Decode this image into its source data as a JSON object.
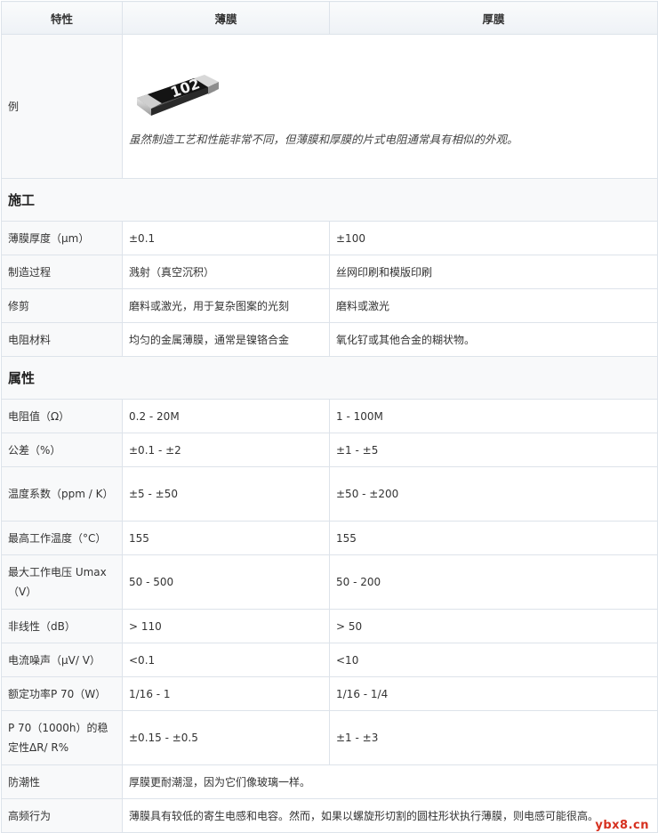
{
  "header": {
    "col1": "特性",
    "col2": "薄膜",
    "col3": "厚膜"
  },
  "example": {
    "label": "例",
    "chip_text": "102",
    "caption": "虽然制造工艺和性能非常不同，但薄膜和厚膜的片式电阻通常具有相似的外观。"
  },
  "sections": [
    {
      "title": "施工",
      "rows": [
        {
          "label": "薄膜厚度（μm）",
          "thin": "±0.1",
          "thick": "±100"
        },
        {
          "label": "制造过程",
          "thin": "溅射（真空沉积）",
          "thick": "丝网印刷和模版印刷"
        },
        {
          "label": "修剪",
          "thin": "磨料或激光，用于复杂图案的光刻",
          "thick": "磨料或激光"
        },
        {
          "label": "电阻材料",
          "thin": "均匀的金属薄膜，通常是镍铬合金",
          "thick": "氧化钌或其他合金的糊状物。"
        }
      ]
    },
    {
      "title": "属性",
      "rows": [
        {
          "label": "电阻值（Ω）",
          "thin": "0.2 - 20M",
          "thick": "1 - 100M"
        },
        {
          "label": "公差（%）",
          "thin": "±0.1 - ±2",
          "thick": "±1 - ±5"
        },
        {
          "label": "温度系数（ppm / K）",
          "thin": "±5 - ±50",
          "thick": "±50 - ±200",
          "tall": true
        },
        {
          "label": "最高工作温度（°C）",
          "thin": "155",
          "thick": "155"
        },
        {
          "label": "最大工作电压 Umax（V）",
          "thin": "50 - 500",
          "thick": "50 - 200",
          "tall": true
        },
        {
          "label": "非线性（dB）",
          "thin": "> 110",
          "thick": "> 50"
        },
        {
          "label": "电流噪声（μV/ V）",
          "thin": "<0.1",
          "thick": "<10"
        },
        {
          "label": "额定功率P 70（W）",
          "thin": "1/16 - 1",
          "thick": "1/16 - 1/4"
        },
        {
          "label": "P 70（1000h）的稳定性ΔR/ R%",
          "thin": "±0.15 - ±0.5",
          "thick": "±1 - ±3",
          "tall": true
        },
        {
          "label": "防潮性",
          "merged": "厚膜更耐潮湿，因为它们像玻璃一样。"
        },
        {
          "label": "高频行为",
          "merged": "薄膜具有较低的寄生电感和电容。然而，如果以螺旋形切割的圆柱形状执行薄膜，则电感可能很高。"
        }
      ]
    }
  ],
  "watermark": "ybx8.cn",
  "colors": {
    "border": "#dde3ea",
    "label_bg": "#f8f9fa",
    "watermark": "#d6301f"
  }
}
